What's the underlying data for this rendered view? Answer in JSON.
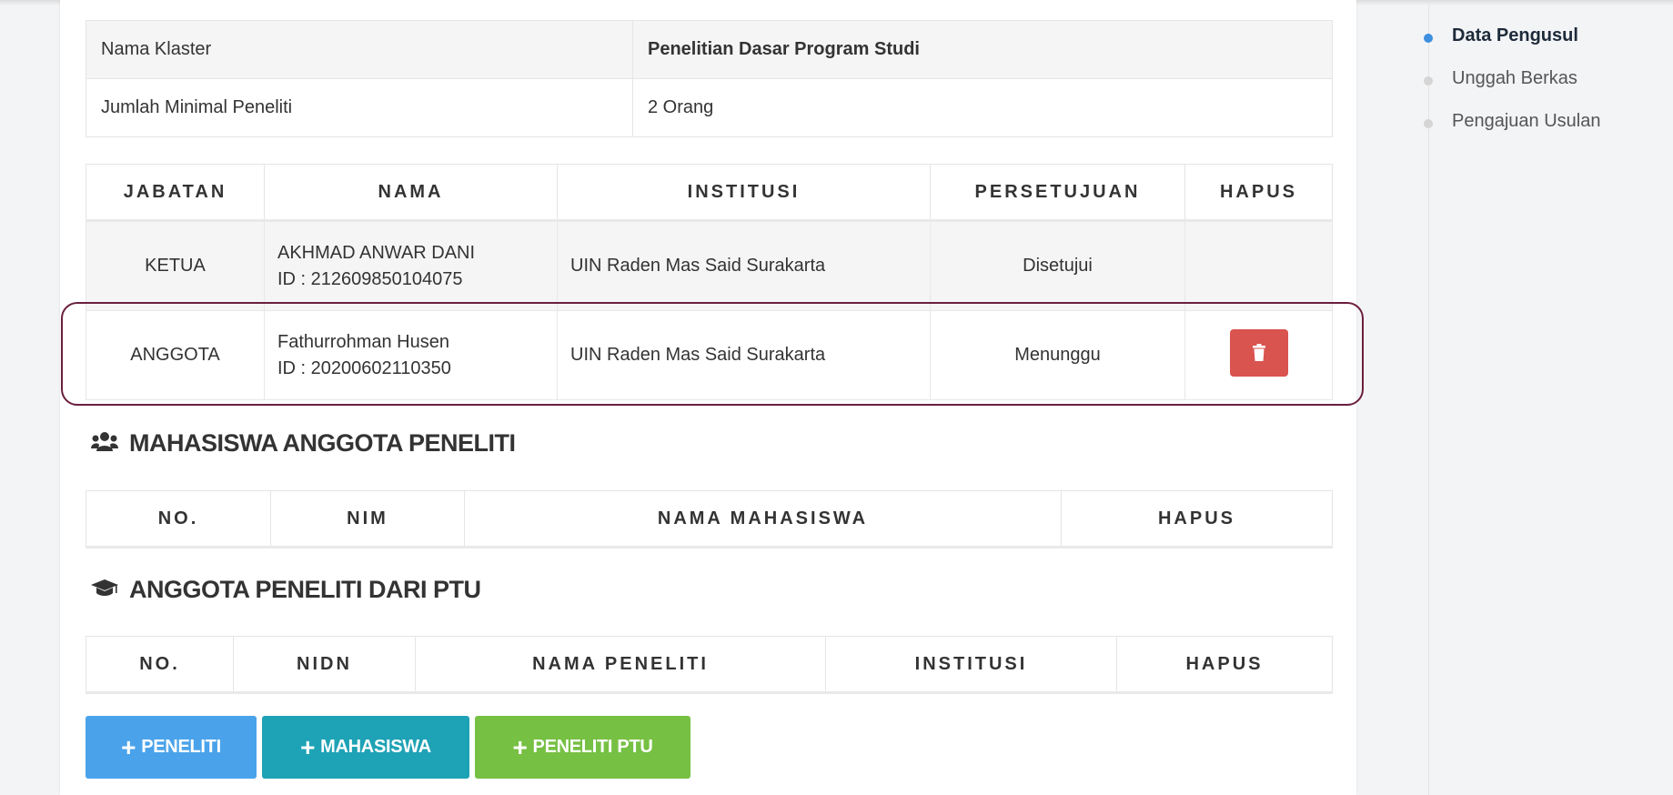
{
  "info_table": {
    "rows": [
      {
        "label": "Nama Klaster",
        "value": "Penelitian Dasar Program Studi"
      },
      {
        "label": "Jumlah Minimal Peneliti",
        "value": "2 Orang"
      }
    ]
  },
  "researchers": {
    "headers": [
      "JABATAN",
      "NAMA",
      "INSTITUSI",
      "PERSETUJUAN",
      "HAPUS"
    ],
    "rows": [
      {
        "role": "KETUA",
        "name": "AKHMAD ANWAR DANI",
        "id": "ID : 212609850104075",
        "institution": "UIN Raden Mas Said Surakarta",
        "status": "Disetujui"
      },
      {
        "role": "ANGGOTA",
        "name": "Fathurrohman Husen",
        "id": "ID : 20200602110350",
        "institution": "UIN Raden Mas Said Surakarta",
        "status": "Menunggu"
      }
    ]
  },
  "students_section": {
    "title": "MAHASISWA ANGGOTA PENELITI",
    "icon": "users-icon",
    "headers": [
      "NO.",
      "NIM",
      "NAMA MAHASISWA",
      "HAPUS"
    ]
  },
  "ptu_section": {
    "title": "ANGGOTA PENELITI DARI PTU",
    "icon": "graduation-cap-icon",
    "headers": [
      "NO.",
      "NIDN",
      "NAMA PENELITI",
      "INSTITUSI",
      "HAPUS"
    ]
  },
  "buttons": {
    "add_researcher": "PENELITI",
    "add_student": "MAHASISWA",
    "add_ptu": "PENELITI PTU",
    "colors": {
      "researcher": "#4aa3ea",
      "student": "#1ea2b5",
      "ptu": "#76c043",
      "delete": "#d9534f"
    }
  },
  "steps": {
    "items": [
      {
        "label": "Data Pengusul",
        "active": true
      },
      {
        "label": "Unggah Berkas",
        "active": false
      },
      {
        "label": "Pengajuan Usulan",
        "active": false
      }
    ],
    "active_color": "#3d8fe0"
  }
}
